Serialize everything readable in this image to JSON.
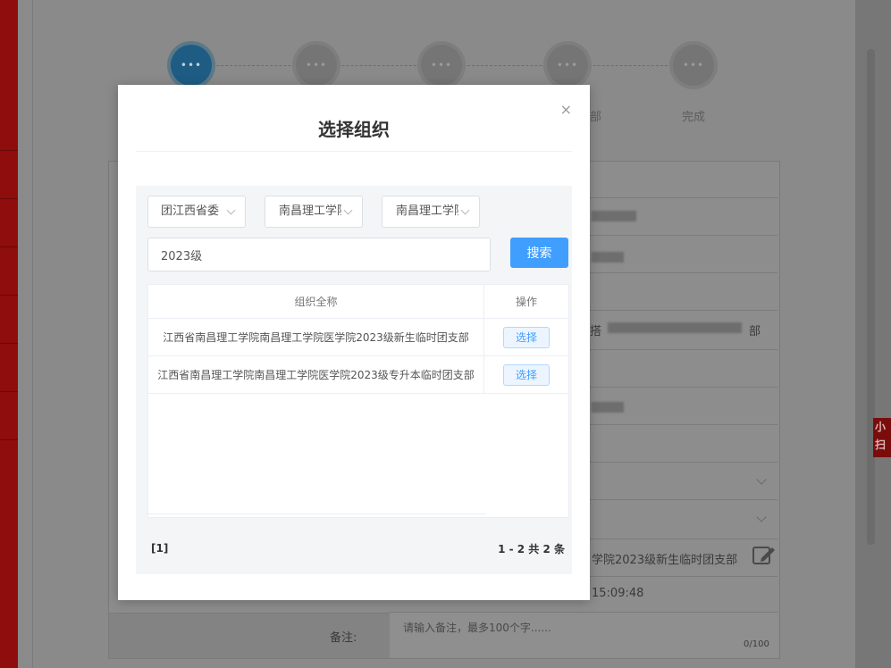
{
  "background": {
    "steps": [
      {
        "dots": "•••",
        "active": true
      },
      {
        "dots": "•••",
        "active": false
      },
      {
        "dots": "•••",
        "active": false
      },
      {
        "dots": "•••",
        "active": false
      },
      {
        "dots": "•••",
        "active": false
      }
    ],
    "step_labels": [
      "部",
      "完成"
    ],
    "side_badge": [
      "小",
      "扫"
    ],
    "org_value": "学院2023级新生临时团支部",
    "org_value_prefix": "搭",
    "org_value_suffix": "部",
    "time_value": "15:09:48",
    "remark_label": "备注:",
    "remark_placeholder": "请输入备注，最多100个字......",
    "remark_counter": "0/100"
  },
  "modal": {
    "title": "选择组织",
    "close_glyph": "×",
    "selects": [
      {
        "value": "团江西省委"
      },
      {
        "value": "南昌理工学院"
      },
      {
        "value": "南昌理工学院"
      }
    ],
    "search": {
      "value": "2023级",
      "button_label": "搜索"
    },
    "table": {
      "headers": {
        "name": "组织全称",
        "op": "操作"
      },
      "rows": [
        {
          "name": "江西省南昌理工学院南昌理工学院医学院2023级新生临时团支部",
          "op": "选择"
        },
        {
          "name": "江西省南昌理工学院南昌理工学院医学院2023级专升本临时团支部",
          "op": "选择"
        }
      ]
    },
    "pager": {
      "pages": "[1]",
      "summary": "1 - 2  共 2 条"
    }
  },
  "colors": {
    "primary": "#409eff",
    "brand_red": "#8f0d0d",
    "active_step": "#1e5c84"
  }
}
